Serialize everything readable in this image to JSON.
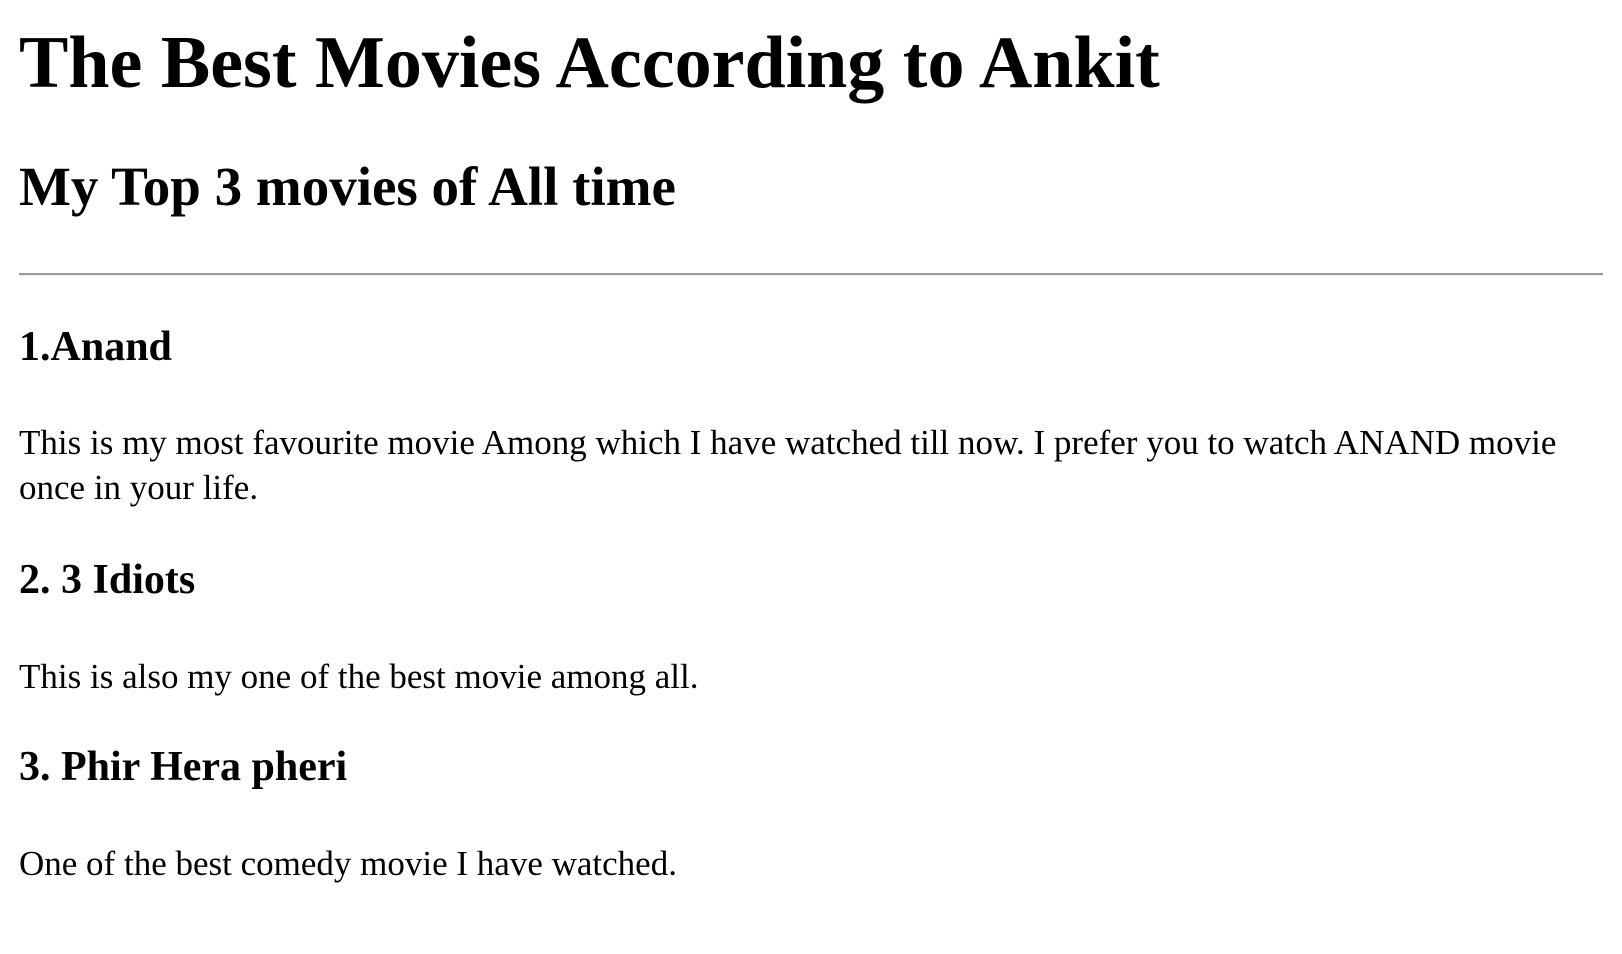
{
  "page": {
    "title": "The Best Movies According to Ankit",
    "subtitle": "My Top 3 movies of All time"
  },
  "movies": [
    {
      "heading": "1.Anand",
      "description": "This is my most favourite movie Among which I have watched till now. I prefer you to watch ANAND movie once in your life."
    },
    {
      "heading": "2. 3 Idiots",
      "description": "This is also my one of the best movie among all."
    },
    {
      "heading": "3. Phir Hera pheri",
      "description": "One of the best comedy movie I have watched."
    }
  ]
}
